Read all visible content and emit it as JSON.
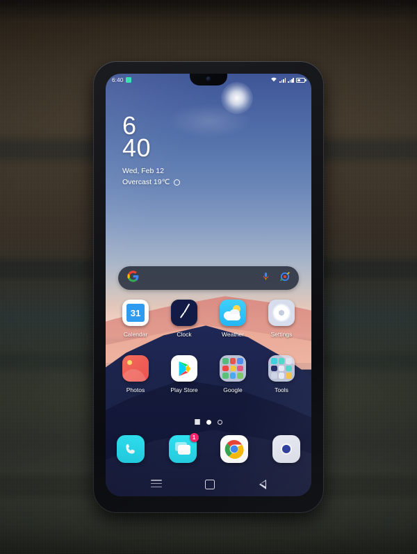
{
  "scene": {
    "description": "photo-of-smartphone-on-fabric",
    "surface_color": "#343a30",
    "phone_body_color": "#121317"
  },
  "status_bar": {
    "time": "6:40",
    "notification_icon": "message-notification-icon",
    "wifi_icon": "wifi-icon",
    "signal_1_icon": "signal-bars-icon",
    "signal_2_icon": "signal-bars-icon",
    "battery_icon": "battery-icon",
    "battery_level_percent": 62
  },
  "clock_widget": {
    "hour": "6",
    "minute": "40",
    "date": "Wed, Feb 12",
    "weather": "Overcast 19℃",
    "weather_icon": "overcast-cloud-icon"
  },
  "search_bar": {
    "google_logo_icon": "google-g-icon",
    "mic_icon": "microphone-icon",
    "lens_icon": "google-lens-icon",
    "placeholder": ""
  },
  "app_rows": [
    {
      "apps": [
        {
          "label": "Calendar",
          "icon": "calendar-icon",
          "day": "31"
        },
        {
          "label": "Clock",
          "icon": "clock-icon"
        },
        {
          "label": "Weather",
          "icon": "weather-icon"
        },
        {
          "label": "Settings",
          "icon": "settings-icon"
        }
      ]
    },
    {
      "apps": [
        {
          "label": "Photos",
          "icon": "photos-icon"
        },
        {
          "label": "Play Store",
          "icon": "play-store-icon"
        },
        {
          "label": "Google",
          "icon": "google-folder-icon"
        },
        {
          "label": "Tools",
          "icon": "tools-folder-icon"
        }
      ]
    }
  ],
  "folder_colors": {
    "google": [
      "#57b97f",
      "#e8554f",
      "#4f8ef0",
      "#ef4444",
      "#f0c93a",
      "#e05a86",
      "#5bc07a",
      "#4aa9ef",
      "#7ec96f"
    ],
    "tools": [
      "#3fd0e0",
      "#4fd8c8",
      "#dfe4f0",
      "#262c66",
      "#e6eaf5",
      "#4fd8c8",
      "#cdd4e6",
      "#e6eaf5",
      "#f2c14a"
    ]
  },
  "page_indicator": {
    "list_icon": "app-list-icon",
    "current_page": 1,
    "total_pages": 2
  },
  "dock": {
    "apps": [
      {
        "label": "Phone",
        "icon": "phone-icon",
        "badge": ""
      },
      {
        "label": "Messages",
        "icon": "messages-icon",
        "badge": "1"
      },
      {
        "label": "Chrome",
        "icon": "chrome-icon",
        "badge": ""
      },
      {
        "label": "Camera",
        "icon": "camera-icon",
        "badge": ""
      }
    ]
  },
  "nav_bar": {
    "recents_icon": "recents-menu-icon",
    "home_icon": "home-square-icon",
    "back_icon": "back-triangle-icon"
  }
}
